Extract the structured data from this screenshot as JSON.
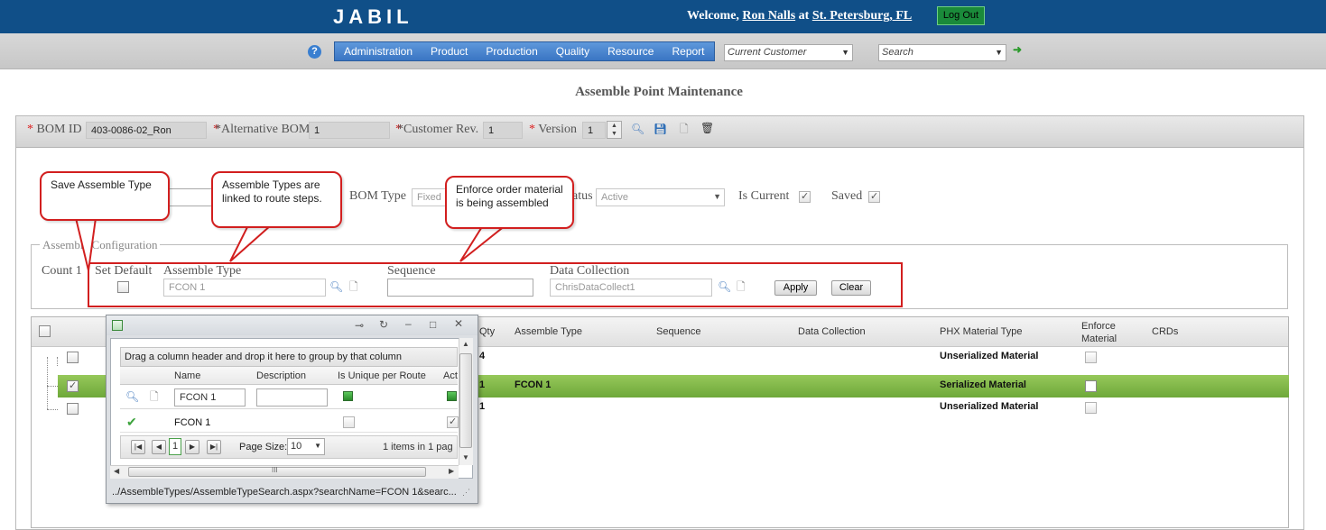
{
  "header": {
    "logo": "JABIL",
    "welcome_prefix": "Welcome,",
    "user_name": "Ron Nalls",
    "at": "at",
    "location": "St. Petersburg, FL",
    "logout_label": "Log Out"
  },
  "nav": {
    "help_label": "?",
    "menu": [
      "Administration",
      "Product",
      "Production",
      "Quality",
      "Resource",
      "Report"
    ],
    "customer_select": "Current Customer",
    "search_select": "Search",
    "go_icon": "arrow-right-icon"
  },
  "page_title": "Assemble Point Maintenance",
  "bom": {
    "bom_id_label": "BOM ID",
    "bom_id_value": "403-0086-02_Ron",
    "alt_bom_label": "*Alternative BOM",
    "alt_bom_value": "1",
    "customer_rev_label": "*Customer Rev.",
    "customer_rev_value": "1",
    "version_label": "Version",
    "version_value": "1",
    "required_mark": "*"
  },
  "details": {
    "bom_type_label": "BOM Type",
    "bom_type_value": "Fixed",
    "status_label": "atus",
    "status_value": "Active",
    "is_current_label": "Is Current",
    "saved_label": "Saved"
  },
  "config": {
    "legend": "Assemble Configuration",
    "count_label": "Count 1",
    "set_default_label": "Set Default",
    "assemble_type_label": "Assemble Type",
    "assemble_type_value": "FCON 1",
    "sequence_label": "Sequence",
    "sequence_value": "",
    "data_collection_label": "Data Collection",
    "data_collection_value": "ChrisDataCollect1",
    "apply_label": "Apply",
    "clear_label": "Clear"
  },
  "grid": {
    "columns": {
      "qty": "Qty",
      "assemble_type": "Assemble Type",
      "sequence": "Sequence",
      "data_collection": "Data Collection",
      "phx_material_type": "PHX Material Type",
      "enforce_material": "Enforce\nMaterial",
      "crds": "CRDs"
    },
    "rows": [
      {
        "qty": "4",
        "assemble_type": "",
        "material_type": "Unserialized Material"
      },
      {
        "qty": "1",
        "assemble_type": "FCON 1",
        "material_type": "Serialized Material"
      },
      {
        "qty": "1",
        "assemble_type": "",
        "material_type": "Unserialized Material"
      }
    ]
  },
  "callouts": {
    "save": "Save Assemble Type",
    "types": "Assemble Types are linked to route steps.",
    "enforce": "Enforce order material is being assembled"
  },
  "popup": {
    "group_hint": "Drag a column header and drop it here to group by that column",
    "columns": [
      "Name",
      "Description",
      "Is Unique per Route",
      "Act"
    ],
    "filter_name": "FCON 1",
    "filter_description": "",
    "row_name": "FCON 1",
    "page_number": "1",
    "page_size_label": "Page Size:",
    "page_size_value": "10",
    "items_info": "1 items in 1 pag",
    "hscroll_grip": "III",
    "status_url": "../AssembleTypes/AssembleTypeSearch.aspx?searchName=FCON 1&searc..."
  }
}
